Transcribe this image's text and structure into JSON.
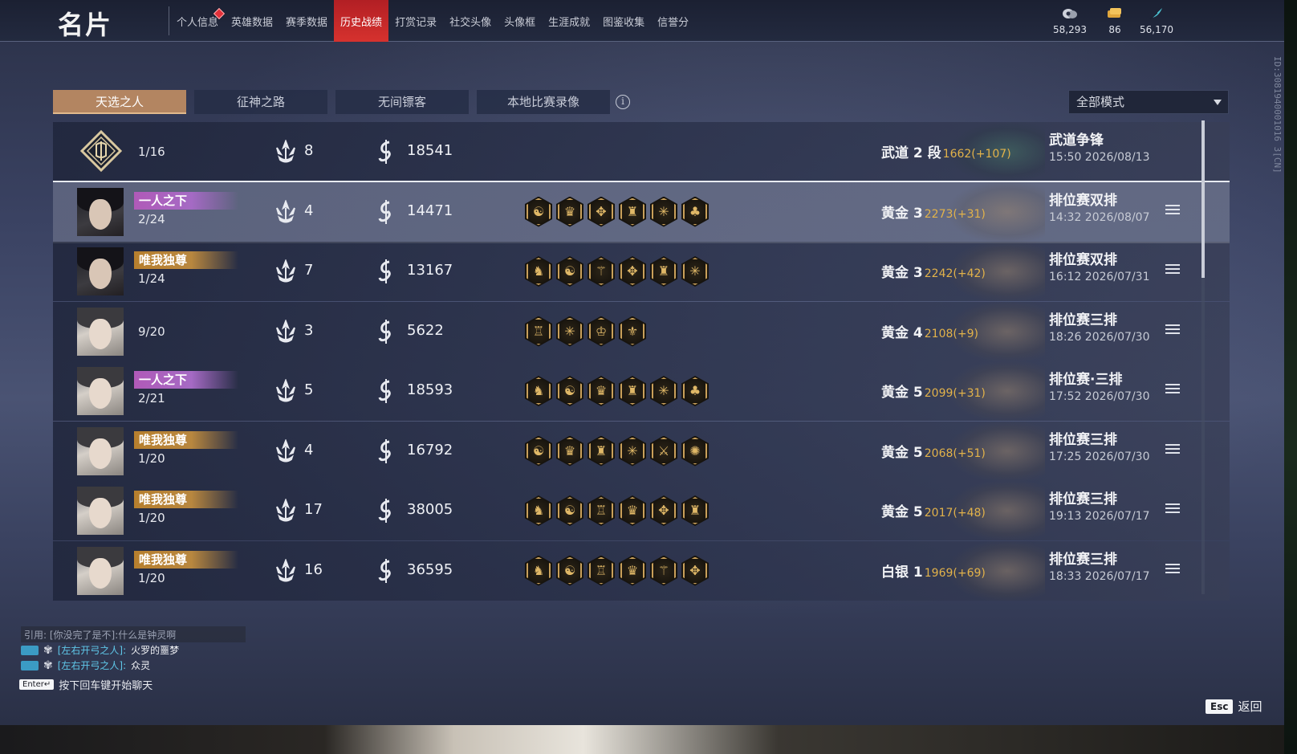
{
  "header": {
    "title": "名片",
    "nav": [
      {
        "label": "个人信息",
        "badge": true
      },
      {
        "label": "英雄数据"
      },
      {
        "label": "赛季数据"
      },
      {
        "label": "历史战绩",
        "active": true
      },
      {
        "label": "打赏记录"
      },
      {
        "label": "社交头像"
      },
      {
        "label": "头像框"
      },
      {
        "label": "生涯成就"
      },
      {
        "label": "图鉴收集"
      },
      {
        "label": "信誉分"
      }
    ],
    "currencies": [
      {
        "icon": "coin-icon",
        "value": "58,293"
      },
      {
        "icon": "ticket-icon",
        "value": "86"
      },
      {
        "icon": "feather-icon",
        "value": "56,170"
      }
    ]
  },
  "side_id": "ID:3081940001016 3[CN]",
  "tabs": [
    {
      "label": "天选之人",
      "active": true
    },
    {
      "label": "征神之路"
    },
    {
      "label": "无间镖客"
    },
    {
      "label": "本地比赛录像"
    }
  ],
  "mode_filter": {
    "value": "全部模式"
  },
  "matches": [
    {
      "type": "emblem",
      "rank": "1/16",
      "kills": "8",
      "score": "18541",
      "badges": [],
      "tier": "武道 2 段",
      "tier_score": "1662(+107)",
      "mode": "武道争锋",
      "time": "15:50 2026/08/13",
      "mythic": true,
      "detail": false
    },
    {
      "type": "avatar",
      "dark": true,
      "title": "一人之下",
      "title_color": "purple",
      "rank": "2/24",
      "kills": "4",
      "score": "14471",
      "badges": [
        "☯",
        "♛",
        "✥",
        "♜",
        "✳",
        "♣"
      ],
      "tier": "黄金 3",
      "tier_score": "2273(+31)",
      "mode": "排位赛双排",
      "time": "14:32 2026/08/07",
      "selected": true,
      "detail": true
    },
    {
      "type": "avatar",
      "dark": true,
      "title": "唯我独尊",
      "title_color": "gold",
      "rank": "1/24",
      "kills": "7",
      "score": "13167",
      "badges": [
        "♞",
        "☯",
        "⚚",
        "✥",
        "♜",
        "✳"
      ],
      "tier": "黄金 3",
      "tier_score": "2242(+42)",
      "mode": "排位赛双排",
      "time": "16:12 2026/07/31",
      "detail": true
    },
    {
      "type": "avatar",
      "rank": "9/20",
      "kills": "3",
      "score": "5622",
      "badges": [
        "♖",
        "✳",
        "♔",
        "⚜"
      ],
      "tier": "黄金 4",
      "tier_score": "2108(+9)",
      "mode": "排位赛三排",
      "time": "18:26 2026/07/30",
      "detail": true
    },
    {
      "type": "avatar",
      "title": "一人之下",
      "title_color": "purple",
      "rank": "2/21",
      "kills": "5",
      "score": "18593",
      "badges": [
        "♞",
        "☯",
        "♛",
        "♜",
        "✳",
        "♣"
      ],
      "tier": "黄金 5",
      "tier_score": "2099(+31)",
      "mode": "排位赛·三排",
      "time": "17:52 2026/07/30",
      "detail": true
    },
    {
      "type": "avatar",
      "title": "唯我独尊",
      "title_color": "gold",
      "rank": "1/20",
      "kills": "4",
      "score": "16792",
      "badges": [
        "☯",
        "♛",
        "♜",
        "✳",
        "⚔",
        "✺"
      ],
      "tier": "黄金 5",
      "tier_score": "2068(+51)",
      "mode": "排位赛三排",
      "time": "17:25 2026/07/30",
      "detail": true
    },
    {
      "type": "avatar",
      "title": "唯我独尊",
      "title_color": "gold",
      "rank": "1/20",
      "kills": "17",
      "score": "38005",
      "badges": [
        "♞",
        "☯",
        "♖",
        "♛",
        "✥",
        "♜"
      ],
      "tier": "黄金 5",
      "tier_score": "2017(+48)",
      "mode": "排位赛三排",
      "time": "19:13 2026/07/17",
      "detail": true
    },
    {
      "type": "avatar",
      "title": "唯我独尊",
      "title_color": "gold",
      "rank": "1/20",
      "kills": "16",
      "score": "36595",
      "badges": [
        "♞",
        "☯",
        "♖",
        "♛",
        "⚚",
        "✥"
      ],
      "tier": "白银 1",
      "tier_score": "1969(+69)",
      "mode": "排位赛三排",
      "time": "18:33 2026/07/17",
      "detail": true
    }
  ],
  "chat": {
    "quote": "引用: [你没完了是不]:什么是钟灵啊",
    "lines": [
      {
        "name": "[左右开弓之人]:",
        "msg": "火罗的噩梦"
      },
      {
        "name": "[左右开弓之人]:",
        "msg": "众灵"
      }
    ],
    "enter_key": "Enter↵",
    "enter_hint": "按下回车键开始聊天"
  },
  "esc": {
    "key": "Esc",
    "label": "返回"
  },
  "colors": {
    "accent_red": "#d6322e",
    "tab_active": "#b38561",
    "tier_score": "#e2b24a",
    "chat_name": "#5fc7e8"
  }
}
